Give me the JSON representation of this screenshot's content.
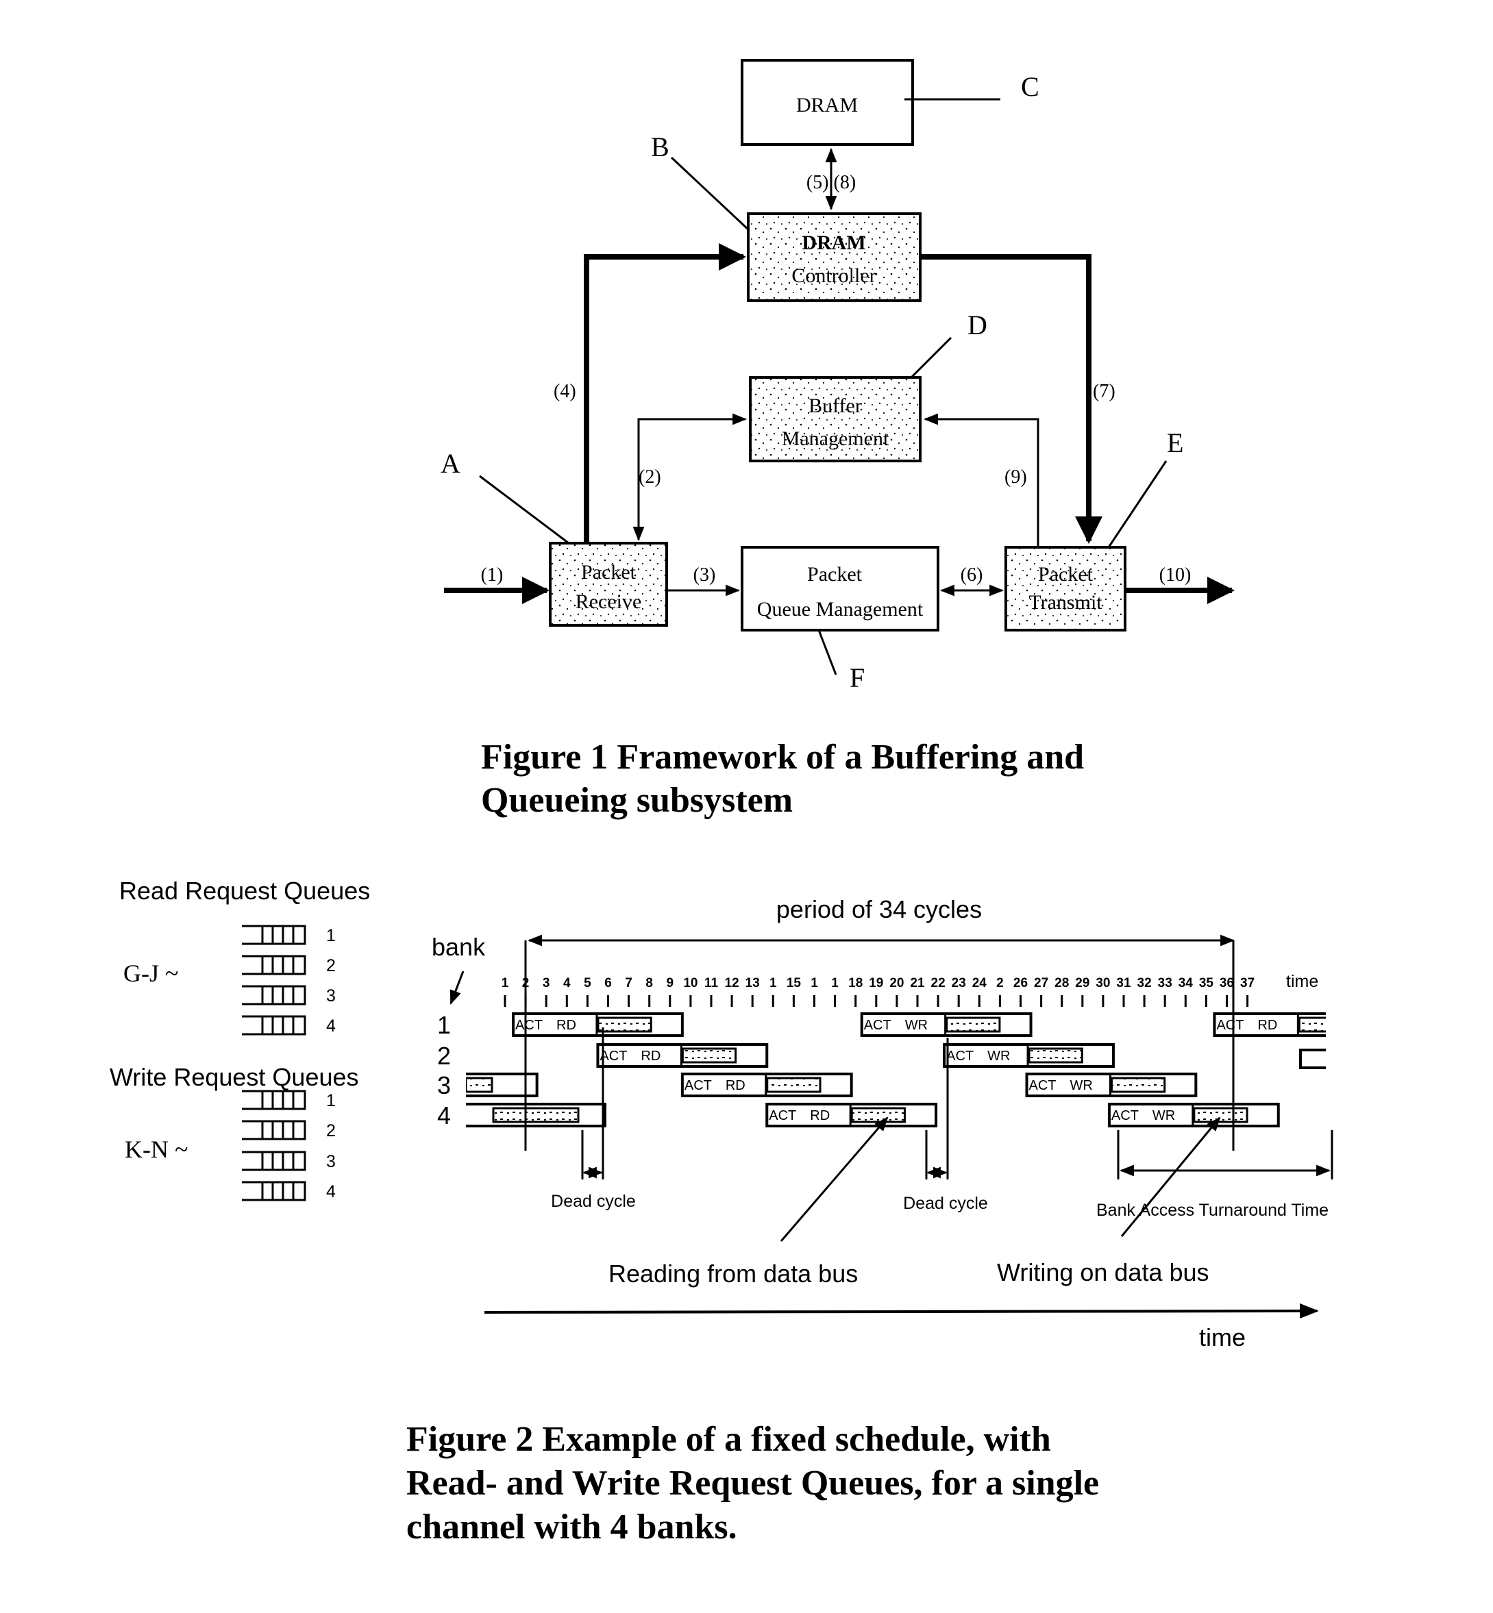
{
  "figure1": {
    "caption_line1": "Figure 1 Framework of a Buffering and",
    "caption_line2": "Queueing subsystem",
    "blocks": {
      "dram": {
        "label": "DRAM",
        "ref": "C"
      },
      "dram_controller": {
        "line1": "DRAM",
        "line2": "Controller",
        "ref": "B"
      },
      "buffer_management": {
        "line1": "Buffer",
        "line2": "Management",
        "ref": "D"
      },
      "packet_receive": {
        "line1": "Packet",
        "line2": "Receive",
        "ref": "A"
      },
      "packet_queue_management": {
        "line1": "Packet",
        "line2": "Queue Management",
        "ref": "F"
      },
      "packet_transmit": {
        "line1": "Packet",
        "line2": "Transmit",
        "ref": "E"
      }
    },
    "flows": {
      "f1": "(1)",
      "f2": "(2)",
      "f3": "(3)",
      "f4": "(4)",
      "f5_8": "(5) (8)",
      "f6": "(6)",
      "f7": "(7)",
      "f9": "(9)",
      "f10": "(10)"
    }
  },
  "figure2": {
    "caption_line1": "Figure 2  Example of a fixed schedule, with",
    "caption_line2": "Read- and Write Request Queues, for a single",
    "caption_line3": "channel with 4 banks.",
    "read_queues": {
      "title": "Read Request Queues",
      "group": "G-J ~",
      "ids": [
        "1",
        "2",
        "3",
        "4"
      ]
    },
    "write_queues": {
      "title": "Write Request Queues",
      "group": "K-N ~",
      "ids": [
        "1",
        "2",
        "3",
        "4"
      ]
    },
    "period_label": "period of 34 cycles",
    "bank_label": "bank",
    "time_label": "time",
    "time_axis_label": "time",
    "dead_cycle_label": "Dead cycle",
    "turnaround_label": "Bank Access Turnaround Time",
    "reading_label": "Reading from data bus",
    "writing_label": "Writing on data bus",
    "cycle_labels": [
      "1",
      "2",
      "3",
      "4",
      "5",
      "6",
      "7",
      "8",
      "9",
      "10",
      "11",
      "12",
      "13",
      "1",
      "15",
      "1",
      "1",
      "18",
      "19",
      "20",
      "21",
      "22",
      "23",
      "24",
      "2",
      "26",
      "27",
      "28",
      "29",
      "30",
      "31",
      "32",
      "33",
      "34",
      "35",
      "36",
      "37"
    ],
    "banks": [
      "1",
      "2",
      "3",
      "4"
    ],
    "commands": {
      "act": "ACT",
      "read": "RD",
      "write": "WR"
    },
    "schedule": [
      {
        "bank": 1,
        "start": 1.4,
        "op": "RD"
      },
      {
        "bank": 2,
        "start": 5.5,
        "op": "RD"
      },
      {
        "bank": 3,
        "start": 9.6,
        "op": "RD"
      },
      {
        "bank": 4,
        "start": 13.7,
        "op": "RD"
      },
      {
        "bank": 1,
        "start": 18.3,
        "op": "WR"
      },
      {
        "bank": 2,
        "start": 22.3,
        "op": "WR"
      },
      {
        "bank": 3,
        "start": 26.3,
        "op": "WR"
      },
      {
        "bank": 4,
        "start": 30.3,
        "op": "WR"
      },
      {
        "bank": 1,
        "start": 35.4,
        "op": "RD"
      }
    ]
  }
}
